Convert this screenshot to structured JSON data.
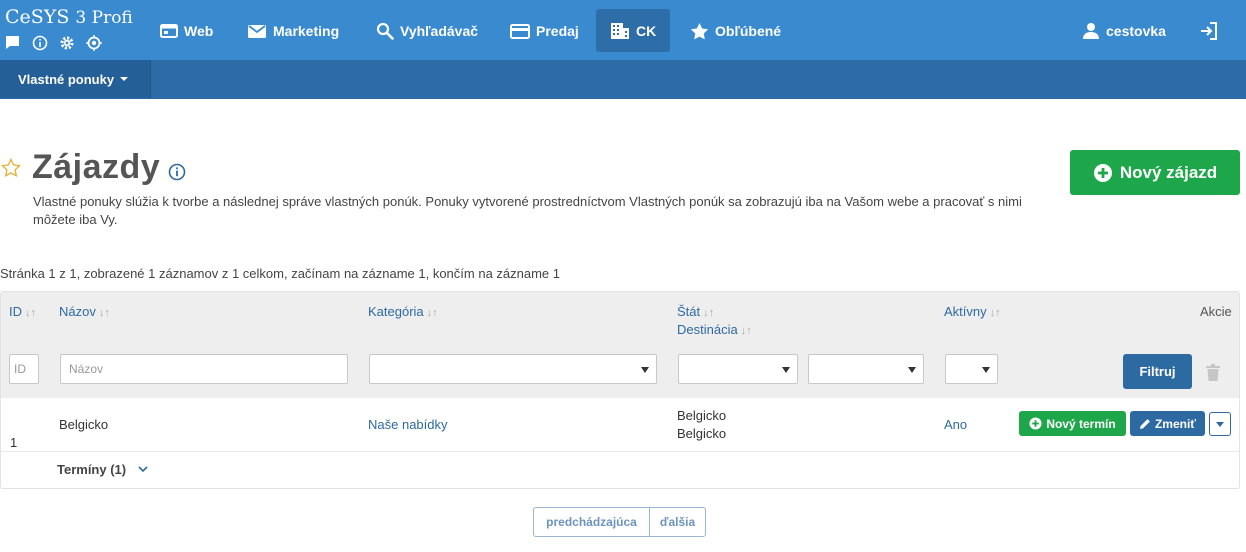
{
  "header": {
    "logo_brand": "CeSYS",
    "logo_version": "3 Profi",
    "logo_icons": [
      "chat-icon",
      "info-icon",
      "gear-icon",
      "target-icon"
    ],
    "nav": [
      {
        "label": "Web",
        "icon": "browser-window-icon"
      },
      {
        "label": "Marketing",
        "icon": "envelope-icon"
      },
      {
        "label": "Vyhľadávač",
        "icon": "search-icon"
      },
      {
        "label": "Predaj",
        "icon": "credit-card-icon"
      },
      {
        "label": "CK",
        "icon": "building-icon",
        "active": true
      },
      {
        "label": "Obľúbené",
        "icon": "star-icon"
      }
    ],
    "user": {
      "label": "cestovka",
      "icon": "user-icon"
    },
    "logout_icon": "logout-icon"
  },
  "subnav": {
    "tab_label": "Vlastné ponuky"
  },
  "page": {
    "title": "Zájazdy",
    "description": "Vlastné ponuky slúžia k tvorbe a následnej správe vlastných ponúk. Ponuky vytvorené prostredníctvom Vlastných ponúk sa zobrazujú iba na Vašom webe a pracovať s nimi môžete iba Vy.",
    "new_button_label": "Nový zájazd",
    "summary": "Stránka 1 z 1, zobrazené 1 záznamov z 1 celkom, začínam na zázname 1, končím na zázname 1"
  },
  "table": {
    "columns": {
      "id": "ID",
      "name": "Názov",
      "category": "Kategória",
      "state": "Štát",
      "destination": "Destinácia",
      "active": "Aktívny",
      "actions": "Akcie"
    },
    "filters": {
      "id_placeholder": "ID",
      "name_placeholder": "Názov",
      "category_value": "",
      "state_value": "",
      "destination_value": "",
      "active_value": "",
      "filter_button": "Filtruj"
    },
    "rows": [
      {
        "id": "1",
        "name": "Belgicko",
        "category": "Naše nabídky",
        "state": "Belgicko",
        "destination": "Belgicko",
        "active": "Ano",
        "btn_new_term": "Nový termín",
        "btn_edit": "Zmeniť",
        "terms_label": "Termíny (1)"
      }
    ]
  },
  "pagination": {
    "prev": "predchádzajúca",
    "next": "ďalšia"
  },
  "colors": {
    "header": "#3a8ad0",
    "subheader": "#2c6ba6",
    "primary": "#2e6aa2",
    "success": "#1ea74a"
  }
}
